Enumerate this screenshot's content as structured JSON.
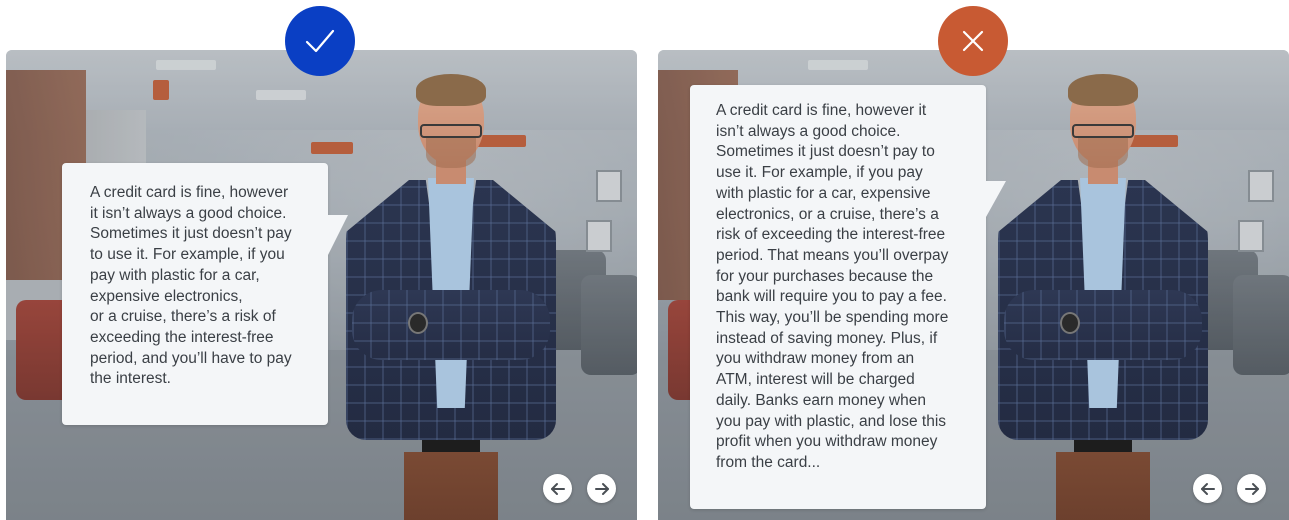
{
  "colors": {
    "correct": "#0a3fc4",
    "incorrect": "#c85a33",
    "bubble_bg": "#f4f6f8",
    "text": "#3a3f45"
  },
  "badges": {
    "correct_icon": "checkmark-icon",
    "incorrect_icon": "cross-icon"
  },
  "left_panel": {
    "bubble_text": "A credit card is fine, however\nit isn’t always a good choice.\nSometimes it just doesn’t pay\nto use it. For example, if you\npay with plastic for a car,\nexpensive electronics,\nor a cruise, there’s a risk of\nexceeding the interest-free\nperiod, and you’ll have to pay\nthe interest."
  },
  "right_panel": {
    "bubble_text": "A credit card is fine, however it\nisn’t always a good choice.\nSometimes it just doesn’t pay to\nuse it. For example, if you pay\nwith plastic for a car, expensive\nelectronics, or a cruise, there’s a\nrisk of exceeding the interest-free\nperiod. That means you’ll overpay\nfor your purchases because the\nbank will require you to pay a fee.\nThis way, you’ll be spending more\ninstead of saving money. Plus, if\nyou withdraw money from an\nATM, interest will be charged\ndaily. Banks earn money when\nyou pay with plastic, and lose this\nprofit when you withdraw money\nfrom the card..."
  },
  "nav": {
    "prev_icon": "arrow-left-icon",
    "next_icon": "arrow-right-icon"
  }
}
